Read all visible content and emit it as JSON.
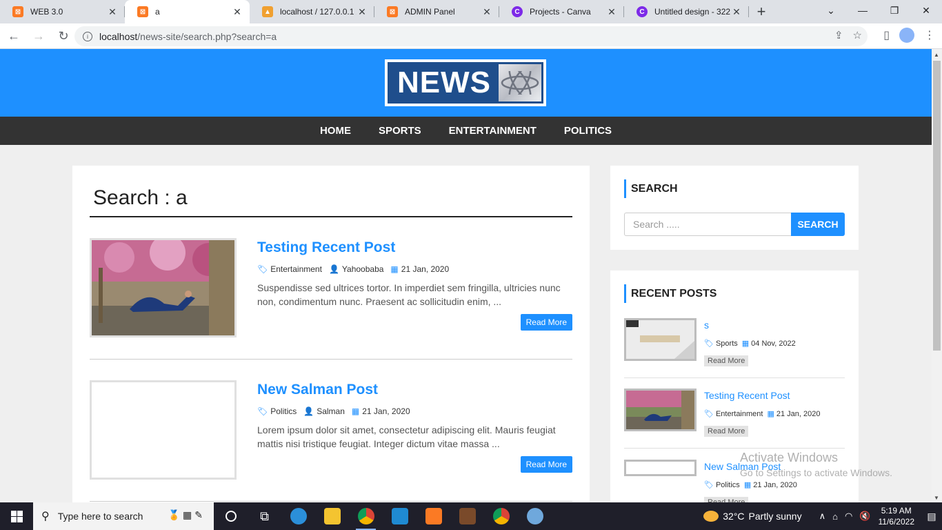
{
  "browser": {
    "tabs": [
      {
        "title": "WEB 3.0",
        "fav_color": "#fb7a24",
        "fav_glyph": "⊠"
      },
      {
        "title": "a",
        "fav_color": "#fb7a24",
        "fav_glyph": "⊠"
      },
      {
        "title": "localhost / 127.0.0.1 / ",
        "fav_color": "#f0a030",
        "fav_glyph": "▲"
      },
      {
        "title": "ADMIN Panel",
        "fav_color": "#fb7a24",
        "fav_glyph": "⊠"
      },
      {
        "title": "Projects - Canva",
        "fav_color": "#7d2ae8",
        "fav_glyph": "C"
      },
      {
        "title": "Untitled design - 322",
        "fav_color": "#7d2ae8",
        "fav_glyph": "C"
      }
    ],
    "url_host": "localhost",
    "url_path": "/news-site/search.php?search=a"
  },
  "site": {
    "logo_text": "NEWS",
    "menu": [
      "HOME",
      "SPORTS",
      "ENTERTAINMENT",
      "POLITICS"
    ]
  },
  "search_page": {
    "heading": "Search : a",
    "posts": [
      {
        "title": "Testing Recent Post",
        "category": "Entertainment",
        "author": "Yahoobaba",
        "date": "21 Jan, 2020",
        "excerpt": "Suspendisse sed ultrices tortor. In imperdiet sem fringilla, ultricies nunc non, condimentum nunc. Praesent ac sollicitudin enim, ...",
        "read_more": "Read More"
      },
      {
        "title": "New Salman Post",
        "category": "Politics",
        "author": "Salman",
        "date": "21 Jan, 2020",
        "excerpt": "Lorem ipsum dolor sit amet, consectetur adipiscing elit. Mauris feugiat mattis nisi tristique feugiat. Integer dictum vitae massa ...",
        "read_more": "Read More"
      }
    ]
  },
  "sidebar": {
    "search_title": "SEARCH",
    "search_placeholder": "Search .....",
    "search_button": "SEARCH",
    "recent_title": "RECENT POSTS",
    "recent": [
      {
        "title": "s",
        "category": "Sports",
        "date": "04 Nov, 2022",
        "read_more": "Read More"
      },
      {
        "title": "Testing Recent Post",
        "category": "Entertainment",
        "date": "21 Jan, 2020",
        "read_more": "Read More"
      },
      {
        "title": "New Salman Post",
        "category": "Politics",
        "date": "21 Jan, 2020",
        "read_more": "Read More"
      }
    ]
  },
  "overlay": {
    "activate_line1": "Activate Windows",
    "activate_line2": "Go to Settings to activate Windows."
  },
  "taskbar": {
    "search_placeholder": "Type here to search",
    "weather_temp": "32°C",
    "weather_desc": "Partly sunny",
    "time": "5:19 AM",
    "date": "11/6/2022"
  },
  "colors": {
    "brand_blue": "#1e90ff",
    "menu_bg": "#333333"
  }
}
